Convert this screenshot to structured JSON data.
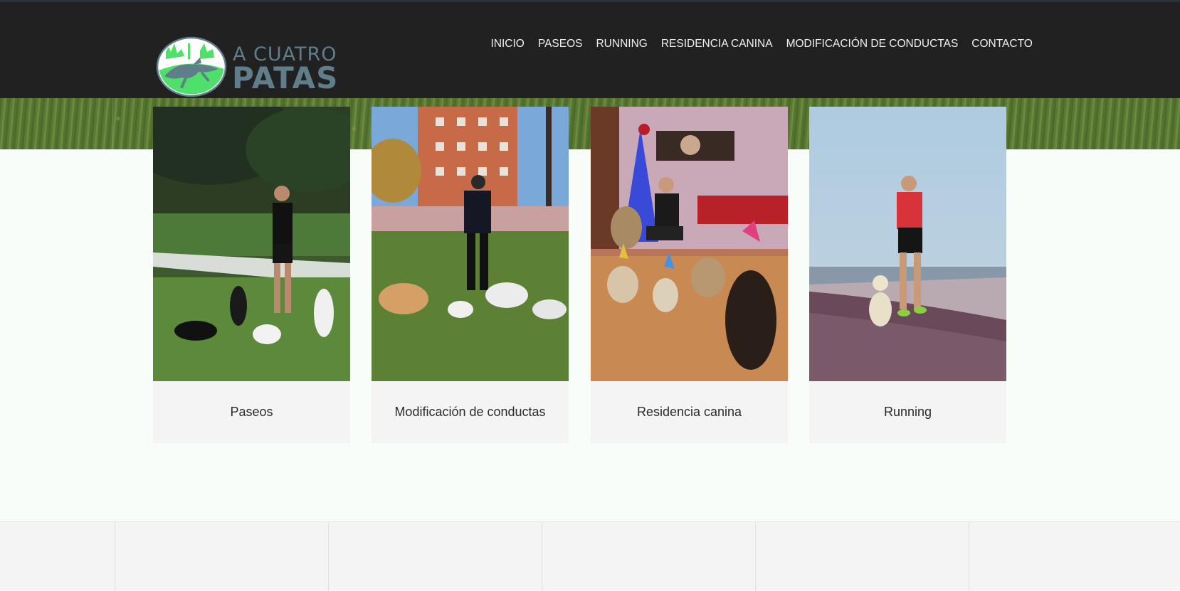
{
  "header": {
    "logo": {
      "line1": "A CUATRO",
      "line2": "PATAS"
    },
    "nav": [
      {
        "label": "INICIO"
      },
      {
        "label": "PASEOS"
      },
      {
        "label": "RUNNING"
      },
      {
        "label": "RESIDENCIA CANINA"
      },
      {
        "label": "MODIFICACIÓN DE CONDUCTAS"
      },
      {
        "label": "CONTACTO"
      }
    ]
  },
  "cards": [
    {
      "caption": "Paseos",
      "photo": "walker-with-dogs-in-park"
    },
    {
      "caption": "Modificación de conductas",
      "photo": "trainer-with-dogs-on-grass"
    },
    {
      "caption": "Residencia canina",
      "photo": "dogs-with-party-hats-indoors"
    },
    {
      "caption": "Running",
      "photo": "runner-with-dog-on-hill"
    }
  ],
  "colors": {
    "header_bg": "#212121",
    "logo_text": "#5f7e8a",
    "logo_green": "#4ee06a",
    "page_bg": "#f8fdf9",
    "card_bg": "#f4f4f4"
  }
}
